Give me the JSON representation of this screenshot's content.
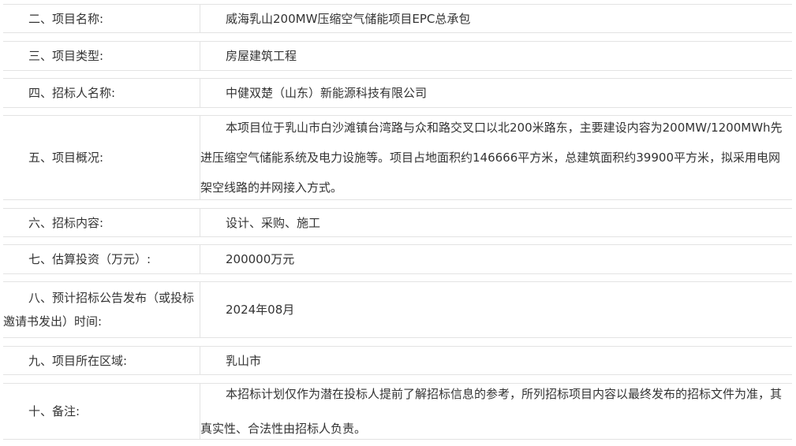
{
  "rows": [
    {
      "label": "二、项目名称:",
      "value": "威海乳山200MW压缩空气储能项目EPC总承包"
    },
    {
      "label": "三、项目类型:",
      "value": "房屋建筑工程"
    },
    {
      "label": "四、招标人名称:",
      "value": "中健双楚（山东）新能源科技有限公司"
    },
    {
      "label": "五、项目概况:",
      "value": "本项目位于乳山市白沙滩镇台湾路与众和路交叉口以北200米路东，主要建设内容为200MW/1200MWh先进压缩空气储能系统及电力设施等。项目占地面积约146666平方米，总建筑面积约39900平方米，拟采用电网架空线路的并网接入方式。"
    },
    {
      "label": "六、招标内容:",
      "value": "设计、采购、施工"
    },
    {
      "label": "七、估算投资（万元）:",
      "value": "200000万元"
    },
    {
      "label": "八、预计招标公告发布（或投标邀请书发出）时间:",
      "value": "2024年08月"
    },
    {
      "label": "九、项目所在区域:",
      "value": "乳山市"
    },
    {
      "label": "十、备注:",
      "value": "本招标计划仅作为潜在投标人提前了解招标信息的参考，所列招标项目内容以最终发布的招标文件为准，其真实性、合法性由招标人负责。"
    }
  ]
}
